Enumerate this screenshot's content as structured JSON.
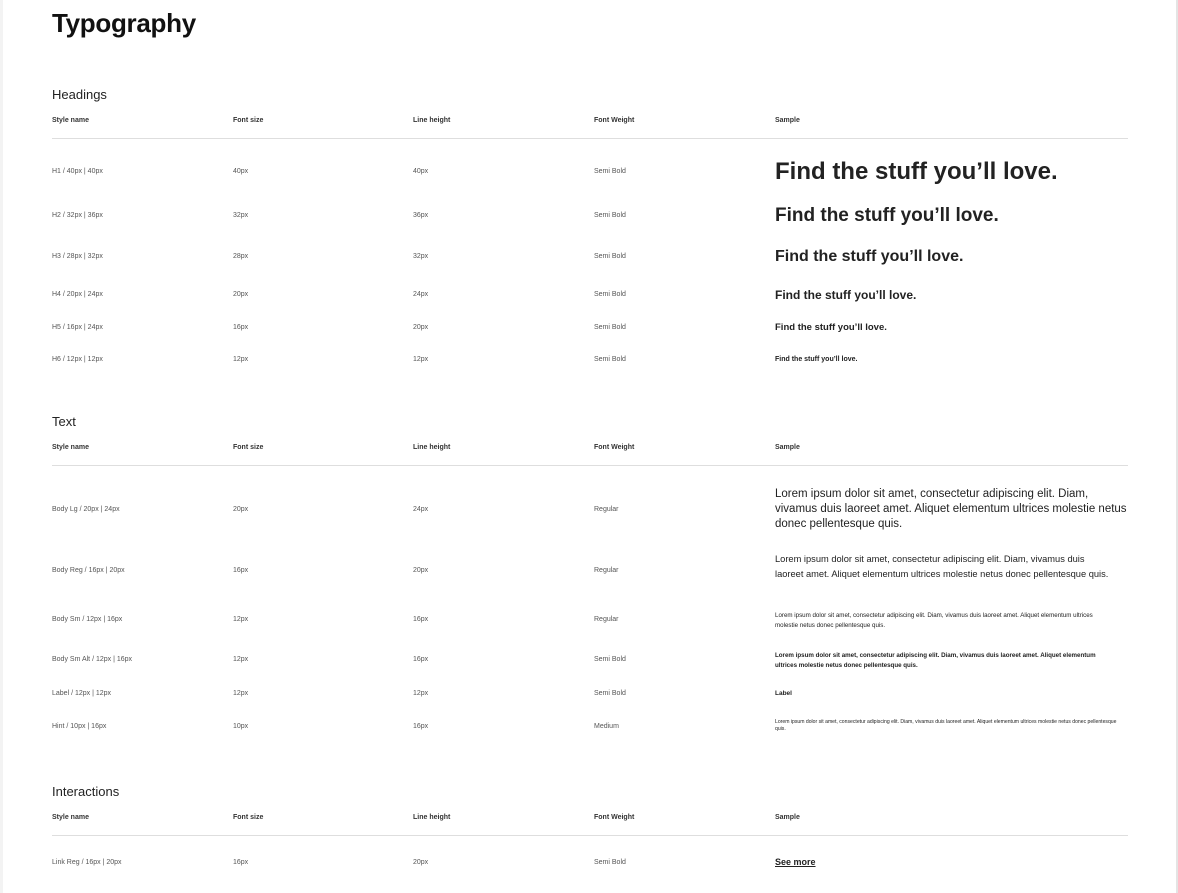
{
  "page": {
    "title": "Typography"
  },
  "columns": {
    "style_name": "Style name",
    "font_size": "Font size",
    "line_height": "Line height",
    "font_weight": "Font Weight",
    "sample": "Sample"
  },
  "sections": {
    "headings": {
      "title": "Headings",
      "rows": [
        {
          "style": "H1 / 40px | 40px",
          "size": "40px",
          "line": "40px",
          "weight": "Semi Bold",
          "sample": "Find the stuff you’ll love."
        },
        {
          "style": "H2 / 32px | 36px",
          "size": "32px",
          "line": "36px",
          "weight": "Semi Bold",
          "sample": "Find the stuff you’ll love."
        },
        {
          "style": "H3 / 28px | 32px",
          "size": "28px",
          "line": "32px",
          "weight": "Semi Bold",
          "sample": "Find the stuff you’ll love."
        },
        {
          "style": "H4 / 20px | 24px",
          "size": "20px",
          "line": "24px",
          "weight": "Semi Bold",
          "sample": "Find the stuff you’ll love."
        },
        {
          "style": "H5 / 16px | 24px",
          "size": "16px",
          "line": "20px",
          "weight": "Semi Bold",
          "sample": "Find the stuff you’ll love."
        },
        {
          "style": "H6 / 12px | 12px",
          "size": "12px",
          "line": "12px",
          "weight": "Semi Bold",
          "sample": "Find the stuff you’ll love."
        }
      ]
    },
    "text": {
      "title": "Text",
      "rows": [
        {
          "style": "Body Lg  / 20px | 24px",
          "size": "20px",
          "line": "24px",
          "weight": "Regular",
          "sample": "Lorem ipsum dolor sit amet, consectetur adipiscing elit. Diam, vivamus duis laoreet amet. Aliquet elementum ultrices molestie netus donec pellentesque quis."
        },
        {
          "style": "Body Reg  / 16px | 20px",
          "size": "16px",
          "line": "20px",
          "weight": "Regular",
          "sample": "Lorem ipsum dolor sit amet, consectetur adipiscing elit. Diam, vivamus duis laoreet amet. Aliquet elementum ultrices molestie netus donec pellentesque quis."
        },
        {
          "style": "Body Sm  / 12px | 16px",
          "size": "12px",
          "line": "16px",
          "weight": "Regular",
          "sample": "Lorem ipsum dolor sit amet, consectetur adipiscing elit. Diam, vivamus duis laoreet amet. Aliquet elementum ultrices molestie netus donec pellentesque quis."
        },
        {
          "style": "Body Sm Alt  / 12px | 16px",
          "size": "12px",
          "line": "16px",
          "weight": "Semi Bold",
          "sample": "Lorem ipsum dolor sit amet, consectetur adipiscing elit. Diam, vivamus duis laoreet amet. Aliquet elementum ultrices molestie netus donec pellentesque quis."
        },
        {
          "style": "Label  / 12px | 12px",
          "size": "12px",
          "line": "12px",
          "weight": "Semi Bold",
          "sample": "Label"
        },
        {
          "style": "Hint  / 10px | 16px",
          "size": "10px",
          "line": "16px",
          "weight": "Medium",
          "sample": "Lorem ipsum dolor sit amet, consectetur adipiscing elit. Diam, vivamus duis laoreet amet. Aliquet elementum ultrices molestie netus donec pellentesque quis."
        }
      ]
    },
    "interactions": {
      "title": "Interactions",
      "rows": [
        {
          "style": "Link Reg  / 16px | 20px",
          "size": "16px",
          "line": "20px",
          "weight": "Semi Bold",
          "sample": "See more"
        }
      ]
    }
  }
}
